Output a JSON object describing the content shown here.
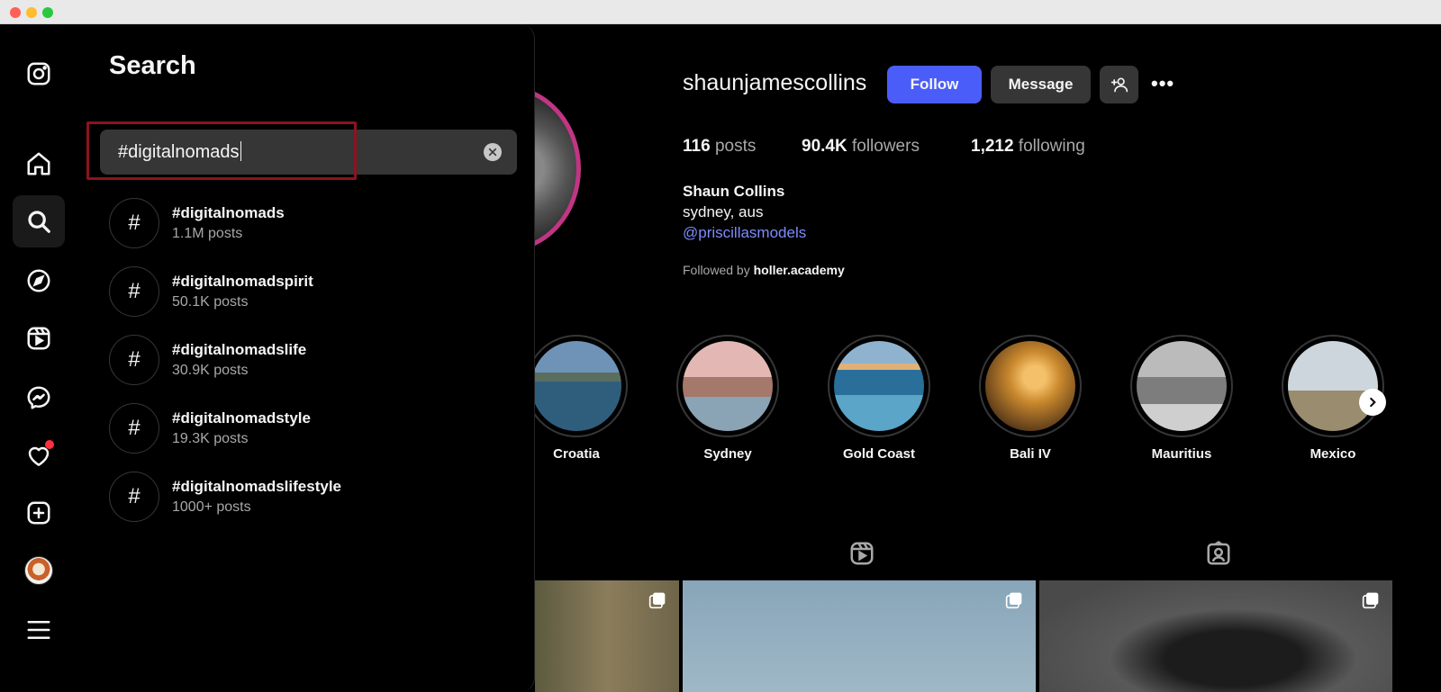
{
  "window": {
    "controls": [
      "close",
      "minimize",
      "maximize"
    ]
  },
  "nav": {
    "items": [
      {
        "name": "instagram-logo-icon",
        "active": false
      },
      {
        "name": "home-icon",
        "active": false
      },
      {
        "name": "search-icon",
        "active": true
      },
      {
        "name": "explore-icon",
        "active": false
      },
      {
        "name": "reels-icon",
        "active": false
      },
      {
        "name": "messenger-icon",
        "active": false
      },
      {
        "name": "notifications-icon",
        "active": false,
        "badge": true
      },
      {
        "name": "create-icon",
        "active": false
      },
      {
        "name": "profile-avatar",
        "active": false
      },
      {
        "name": "menu-icon",
        "active": false
      }
    ]
  },
  "search": {
    "title": "Search",
    "query": "#digitalnomads",
    "results": [
      {
        "tag": "#digitalnomads",
        "count": "1.1M posts"
      },
      {
        "tag": "#digitalnomadspirit",
        "count": "50.1K posts"
      },
      {
        "tag": "#digitalnomadslife",
        "count": "30.9K posts"
      },
      {
        "tag": "#digitalnomadstyle",
        "count": "19.3K posts"
      },
      {
        "tag": "#digitalnomadslifestyle",
        "count": "1000+ posts"
      }
    ],
    "hash_symbol": "#"
  },
  "profile": {
    "username": "shaunjamescollins",
    "follow_label": "Follow",
    "message_label": "Message",
    "stats": {
      "posts_value": "116",
      "posts_label": "posts",
      "followers_value": "90.4K",
      "followers_label": "followers",
      "following_value": "1,212",
      "following_label": "following"
    },
    "full_name": "Shaun Collins",
    "location": "sydney, aus",
    "link": "@priscillasmodels",
    "followed_by_prefix": "Followed by",
    "followed_by_user": "holler.academy"
  },
  "highlights": [
    {
      "label": "Croatia"
    },
    {
      "label": "Sydney"
    },
    {
      "label": "Gold Coast"
    },
    {
      "label": "Bali IV"
    },
    {
      "label": "Mauritius"
    },
    {
      "label": "Mexico"
    }
  ],
  "colors": {
    "accent": "#4a5df9",
    "link": "#7c8cff",
    "notification": "#ff3040",
    "highlight_border": "#8b1420"
  }
}
